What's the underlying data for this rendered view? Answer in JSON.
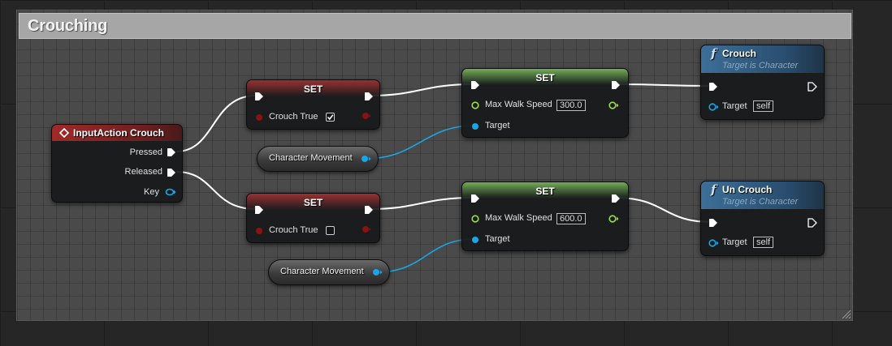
{
  "comment": {
    "title": "Crouching"
  },
  "colors": {
    "exec_wire": "#ffffff",
    "object_pin": "#1aa6e6",
    "float_pin": "#9ae03c",
    "bool_pin": "#8a1212",
    "event_header": "#a02a2a",
    "set_header": "#78b45a",
    "function_header": "#3d6f98"
  },
  "event_node": {
    "title": "InputAction Crouch",
    "icon": "event-diamond-icon",
    "pins": {
      "pressed": "Pressed",
      "released": "Released",
      "key": "Key"
    }
  },
  "set_bool_nodes": [
    {
      "title": "SET",
      "variable_label": "Crouch True",
      "checked": true
    },
    {
      "title": "SET",
      "variable_label": "Crouch True",
      "checked": false
    }
  ],
  "variable_nodes": [
    {
      "label": "Character Movement"
    },
    {
      "label": "Character Movement"
    }
  ],
  "set_speed_nodes": [
    {
      "title": "SET",
      "property_label": "Max Walk Speed",
      "value": "300.0",
      "target_label": "Target"
    },
    {
      "title": "SET",
      "property_label": "Max Walk Speed",
      "value": "600.0",
      "target_label": "Target"
    }
  ],
  "function_nodes": [
    {
      "icon": "function-f-icon",
      "function_glyph": "f",
      "title": "Crouch",
      "subtitle": "Target is Character",
      "target_label": "Target",
      "target_value": "self"
    },
    {
      "icon": "function-f-icon",
      "function_glyph": "f",
      "title": "Un Crouch",
      "subtitle": "Target is Character",
      "target_label": "Target",
      "target_value": "self"
    }
  ]
}
